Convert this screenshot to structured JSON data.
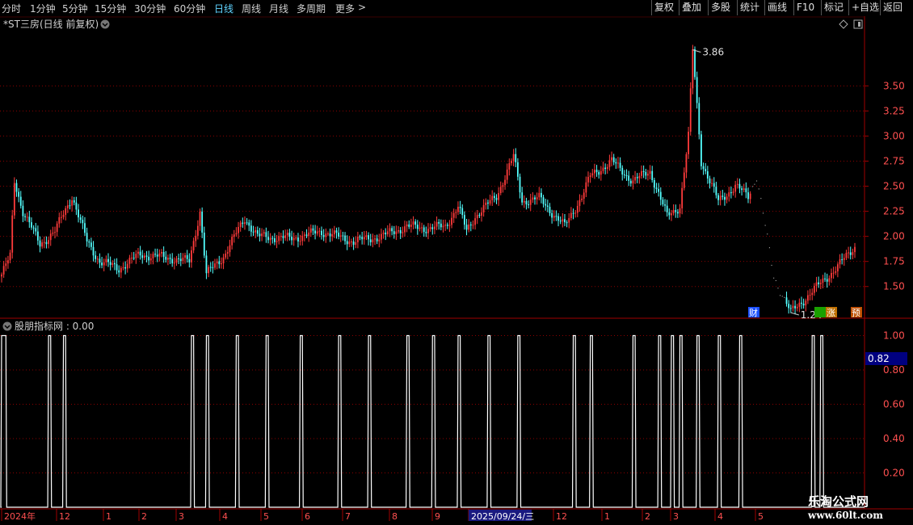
{
  "toolbar": {
    "periods": [
      "分时",
      "1分钟",
      "5分钟",
      "15分钟",
      "30分钟",
      "60分钟",
      "日线",
      "周线",
      "月线",
      "多周期",
      "更多"
    ],
    "active": "日线",
    "more_arrow": ">",
    "right_buttons": [
      "复权",
      "叠加",
      "多股",
      "统计",
      "画线",
      "F10",
      "标记",
      "+自选",
      "返回"
    ]
  },
  "main_title": "*ST三房(日线 前复权)",
  "indicator_title": "股朋指标网 : 0.00",
  "badges": {
    "cai": "财",
    "rongzhang": "涨",
    "yu": "预"
  },
  "cursor_value": "0.82",
  "watermark": {
    "name": "乐淘公式网",
    "url": "www.60lt.com"
  },
  "colors": {
    "up": "#ff3b3b",
    "down": "#54ffff",
    "grid": "#8b0000",
    "line": "#ffffff"
  },
  "chart_data": [
    {
      "type": "candlestick",
      "ylim": [
        1.2,
        4.05
      ],
      "yticks": [
        "1.50",
        "1.75",
        "2.00",
        "2.25",
        "2.50",
        "2.75",
        "3.00",
        "3.25",
        "3.50"
      ],
      "annotations": [
        {
          "label": "3.86",
          "value": 3.86
        },
        {
          "label": "1.24",
          "value": 1.24
        }
      ],
      "grid": true,
      "close_waypoints": [
        [
          0,
          1.62
        ],
        [
          4,
          1.8
        ],
        [
          6,
          2.55
        ],
        [
          10,
          2.25
        ],
        [
          18,
          1.92
        ],
        [
          25,
          2.05
        ],
        [
          33,
          2.4
        ],
        [
          40,
          1.95
        ],
        [
          46,
          1.75
        ],
        [
          55,
          1.68
        ],
        [
          65,
          1.82
        ],
        [
          80,
          1.78
        ],
        [
          88,
          1.75
        ],
        [
          93,
          2.25
        ],
        [
          96,
          1.62
        ],
        [
          104,
          1.8
        ],
        [
          114,
          2.18
        ],
        [
          120,
          2.0
        ],
        [
          136,
          1.98
        ],
        [
          150,
          2.05
        ],
        [
          165,
          1.95
        ],
        [
          178,
          2.0
        ],
        [
          190,
          2.1
        ],
        [
          200,
          2.08
        ],
        [
          208,
          2.1
        ],
        [
          214,
          2.3
        ],
        [
          218,
          2.05
        ],
        [
          222,
          2.2
        ],
        [
          232,
          2.4
        ],
        [
          240,
          2.8
        ],
        [
          244,
          2.35
        ],
        [
          252,
          2.38
        ],
        [
          264,
          2.1
        ],
        [
          272,
          2.4
        ],
        [
          276,
          2.6
        ],
        [
          286,
          2.75
        ],
        [
          296,
          2.55
        ],
        [
          304,
          2.65
        ],
        [
          312,
          2.2
        ],
        [
          318,
          2.3
        ],
        [
          322,
          3.0
        ],
        [
          324,
          3.86
        ],
        [
          328,
          2.75
        ],
        [
          336,
          2.35
        ],
        [
          344,
          2.5
        ],
        [
          350,
          2.4
        ],
        [
          354,
          2.6
        ],
        [
          362,
          1.6
        ],
        [
          370,
          1.24
        ],
        [
          380,
          1.45
        ],
        [
          392,
          1.7
        ],
        [
          400,
          1.9
        ]
      ],
      "gap_bars": [
        352,
        367
      ]
    },
    {
      "type": "line",
      "ylim": [
        0.0,
        1.04
      ],
      "yticks": [
        "0.20",
        "0.40",
        "0.60",
        "0.80",
        "1.00"
      ],
      "grid": true,
      "x_tick_labels": [
        "2024年",
        "12",
        "1",
        "2",
        "3",
        "4",
        "5",
        "6",
        "7",
        "8",
        "9",
        "2025/09/24/三",
        "12",
        "1",
        "2",
        "3",
        "4",
        "5"
      ],
      "pulse_bars": [
        [
          0,
          2
        ],
        [
          22,
          23
        ],
        [
          29,
          30
        ],
        [
          89,
          90
        ],
        [
          96,
          97
        ],
        [
          110,
          111
        ],
        [
          124,
          125
        ],
        [
          140,
          141
        ],
        [
          158,
          159
        ],
        [
          172,
          173
        ],
        [
          190,
          191
        ],
        [
          202,
          203
        ],
        [
          214,
          215
        ],
        [
          228,
          229
        ],
        [
          242,
          243
        ],
        [
          268,
          269
        ],
        [
          276,
          277
        ],
        [
          296,
          297
        ],
        [
          308,
          309
        ],
        [
          314,
          315
        ],
        [
          318,
          319
        ],
        [
          326,
          327
        ],
        [
          336,
          337
        ],
        [
          346,
          347
        ],
        [
          380,
          381
        ],
        [
          384,
          385
        ]
      ]
    }
  ]
}
